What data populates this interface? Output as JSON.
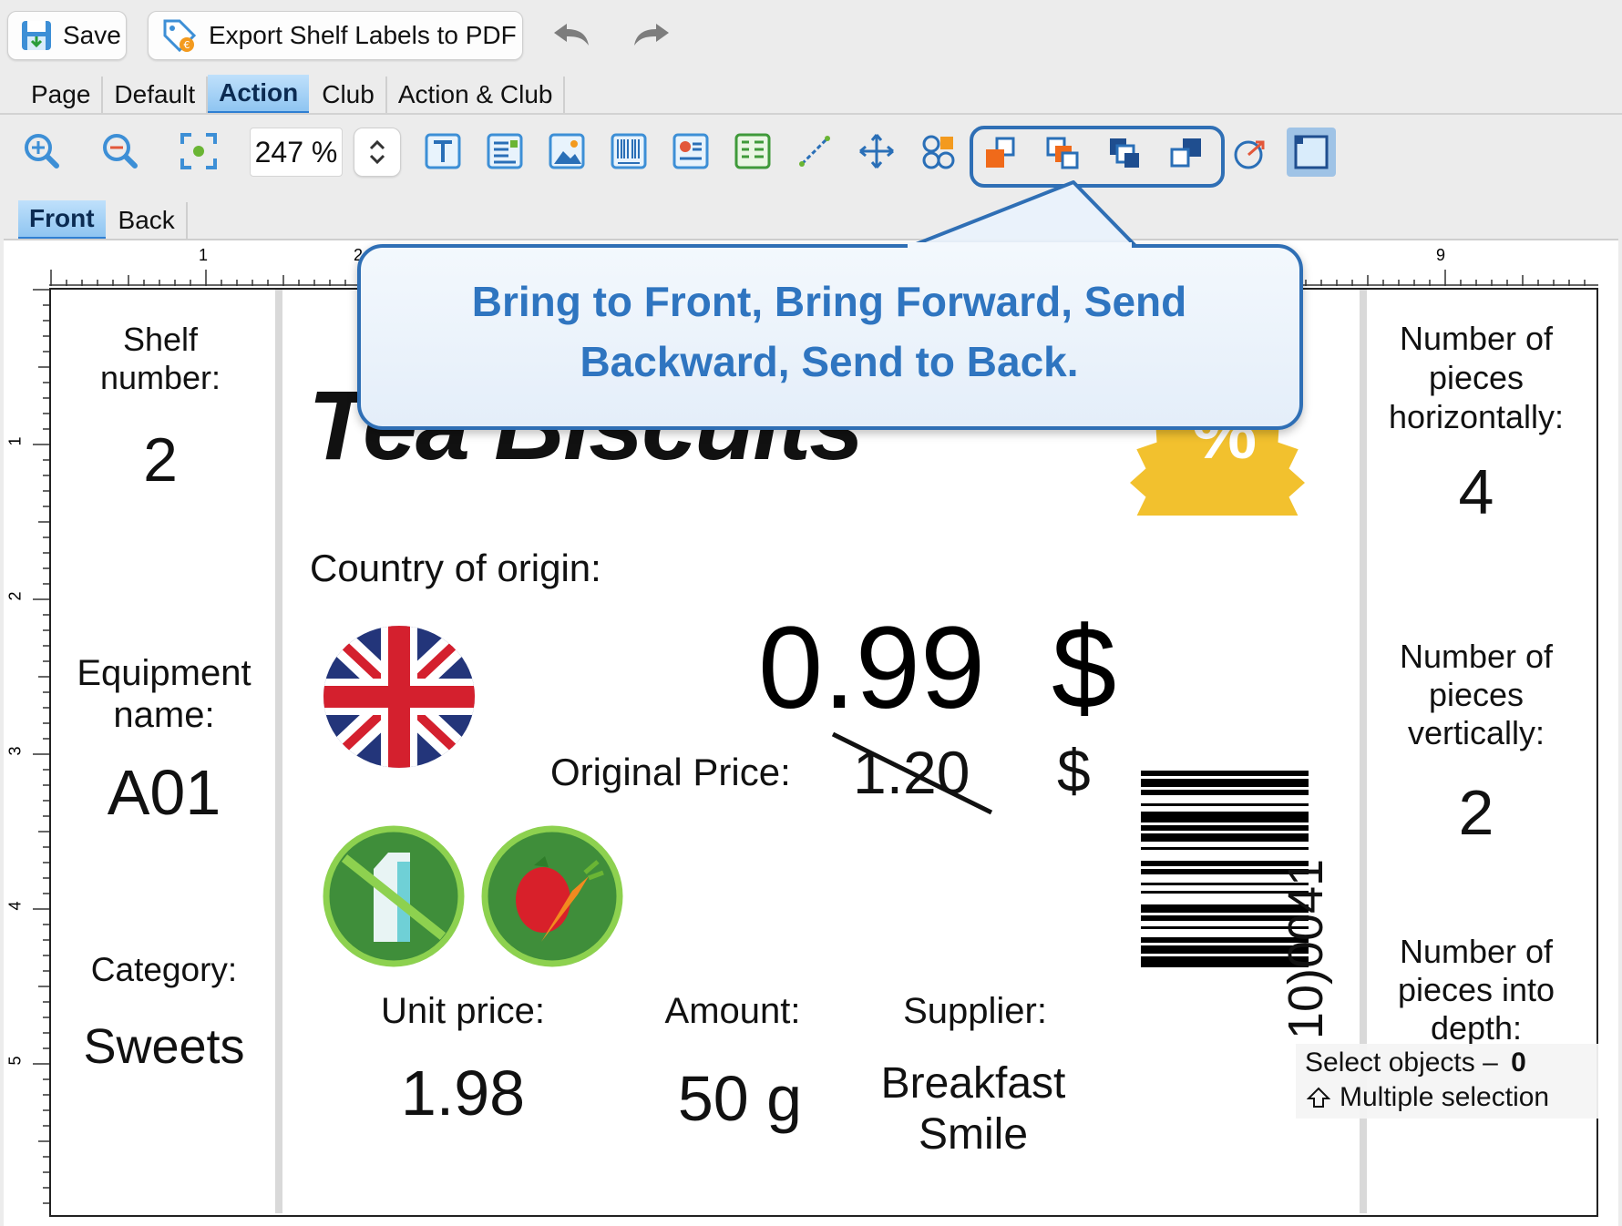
{
  "toolbar": {
    "save_label": "Save",
    "export_label": "Export Shelf Labels to PDF"
  },
  "mode_tabs": [
    "Page",
    "Default",
    "Action",
    "Club",
    "Action & Club"
  ],
  "active_mode_tab": "Action",
  "zoom": {
    "value": "247 %"
  },
  "side_tabs": [
    "Front",
    "Back"
  ],
  "ruler": {
    "top_ticks": [
      "1",
      "2",
      "9"
    ],
    "left_ticks": [
      "1",
      "2",
      "3",
      "4",
      "5"
    ]
  },
  "callout": {
    "text": "Bring to Front, Bring Forward, Send Backward, Send to Back."
  },
  "label": {
    "shelf_title": "Shelf number:",
    "shelf_value": "2",
    "equipment_title": "Equipment name:",
    "equipment_value": "A01",
    "category_title": "Category:",
    "category_value": "Sweets",
    "product_name": "Tea Biscuits",
    "badge_text": "%",
    "country_title": "Country of origin:",
    "price": "0.99",
    "currency": "$",
    "original_price_title": "Original Price:",
    "original_price": "1.20",
    "original_currency": "$",
    "unit_price_title": "Unit price:",
    "unit_price_value": "1.98",
    "amount_title": "Amount:",
    "amount_value": "50 g",
    "supplier_title": "Supplier:",
    "supplier_value_1": "Breakfast",
    "supplier_value_2": "Smile",
    "barcode_text": "10)0041",
    "horiz_title": "Number of pieces horizontally:",
    "horiz_value": "4",
    "vert_title": "Number of pieces vertically:",
    "vert_value": "2",
    "depth_title": "Number of pieces into depth:"
  },
  "status": {
    "select_label": "Select objects –",
    "select_count": "0",
    "multi_label": "Multiple selection"
  },
  "colors": {
    "accent": "#2f6fb5",
    "callout_text": "#2f75c0",
    "badge": "#f2c12e",
    "icon_green": "#6ab534"
  }
}
